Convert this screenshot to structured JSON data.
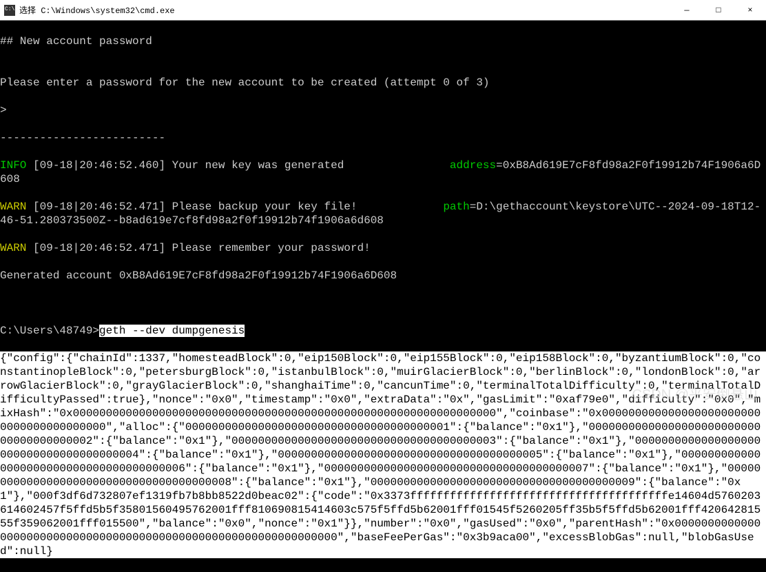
{
  "titlebar": {
    "text": "选择 C:\\Windows\\system32\\cmd.exe"
  },
  "win": {
    "min": "—",
    "max": "□",
    "close": "×"
  },
  "t": {
    "l1": "## New account password",
    "l2": "",
    "l3": "Please enter a password for the new account to be created (attempt 0 of 3)",
    "l4": ">",
    "l5": "-------------------------",
    "info": "INFO ",
    "ts1": "[09-18|20:46:52.460] Your new key was generated                ",
    "addr_lbl": "address",
    "addr_val": "=0xB8Ad619E7cF8fd98a2F0f19912b74F1906a6D608",
    "warn": "WARN ",
    "ts2": "[09-18|20:46:52.471] Please backup your key file!             ",
    "path_lbl": "path",
    "path_val": "=D:\\gethaccount\\keystore\\UTC--2024-09-18T12-46-51.280373500Z--b8ad619e7cf8fd98a2f0f19912b74f1906a6d608",
    "ts3": "[09-18|20:46:52.471] Please remember your password!",
    "gen": "Generated account 0xB8Ad619E7cF8fd98a2F0f19912b74F1906a6D608",
    "prompt": "C:\\Users\\48749>",
    "cmd": "geth --dev dumpgenesis",
    "json": "{\"config\":{\"chainId\":1337,\"homesteadBlock\":0,\"eip150Block\":0,\"eip155Block\":0,\"eip158Block\":0,\"byzantiumBlock\":0,\"constantinopleBlock\":0,\"petersburgBlock\":0,\"istanbulBlock\":0,\"muirGlacierBlock\":0,\"berlinBlock\":0,\"londonBlock\":0,\"arrowGlacierBlock\":0,\"grayGlacierBlock\":0,\"shanghaiTime\":0,\"cancunTime\":0,\"terminalTotalDifficulty\":0,\"terminalTotalDifficultyPassed\":true},\"nonce\":\"0x0\",\"timestamp\":\"0x0\",\"extraData\":\"0x\",\"gasLimit\":\"0xaf79e0\",\"difficulty\":\"0x0\",\"mixHash\":\"0x0000000000000000000000000000000000000000000000000000000000000000\",\"coinbase\":\"0x0000000000000000000000000000000000000000\",\"alloc\":{\"0000000000000000000000000000000000000001\":{\"balance\":\"0x1\"},\"0000000000000000000000000000000000000002\":{\"balance\":\"0x1\"},\"0000000000000000000000000000000000000003\":{\"balance\":\"0x1\"},\"0000000000000000000000000000000000000004\":{\"balance\":\"0x1\"},\"0000000000000000000000000000000000000005\":{\"balance\":\"0x1\"},\"0000000000000000000000000000000000000006\":{\"balance\":\"0x1\"},\"0000000000000000000000000000000000000007\":{\"balance\":\"0x1\"},\"0000000000000000000000000000000000000008\":{\"balance\":\"0x1\"},\"0000000000000000000000000000000000000009\":{\"balance\":\"0x1\"},\"000f3df6d732807ef1319fb7b8bb8522d0beac02\":{\"code\":\"0x3373fffffffffffffffffffffffffffffffffffffffe14604d5760203614602457f5ffd5b5f35801560495762001fff810690815414603c575f5ffd5b62001fff01545f5260205ff35b5f5ffd5b62001fff42064281555f359062001fff015500\",\"balance\":\"0x0\",\"nonce\":\"0x1\"}},\"number\":\"0x0\",\"gasUsed\":\"0x0\",\"parentHash\":\"0x0000000000000000000000000000000000000000000000000000000000000000\",\"baseFeePerGas\":\"0x3b9aca00\",\"excessBlobGas\":null,\"blobGasUsed\":null}"
  },
  "watermark": "CSDN @平安倒悬山"
}
